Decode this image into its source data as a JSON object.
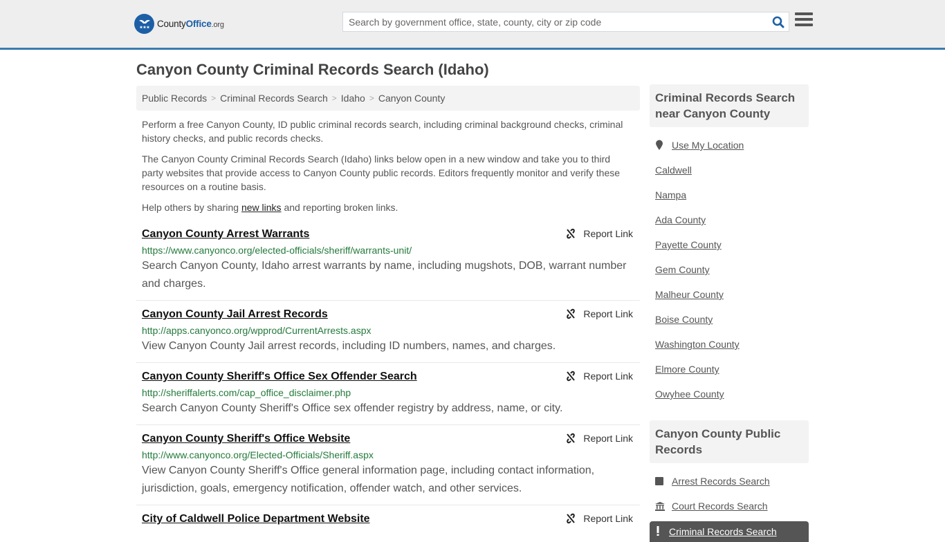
{
  "header": {
    "logo": {
      "county": "County",
      "office": "Office",
      "org": ".org"
    },
    "search_placeholder": "Search by government office, state, county, city or zip code",
    "search_value": "",
    "colors": {
      "brand": "#1d5fa6",
      "accent_line": "#3a7bb0"
    }
  },
  "page": {
    "title": "Canyon County Criminal Records Search (Idaho)"
  },
  "breadcrumb": [
    "Public Records",
    "Criminal Records Search",
    "Idaho",
    "Canyon County"
  ],
  "intro": {
    "p1": "Perform a free Canyon County, ID public criminal records search, including criminal background checks, criminal history checks, and public records checks.",
    "p2": "The Canyon County Criminal Records Search (Idaho) links below open in a new window and take you to third party websites that provide access to Canyon County public records. Editors frequently monitor and verify these resources on a routine basis.",
    "p3_before": "Help others by sharing ",
    "p3_link": "new links",
    "p3_after": " and reporting broken links."
  },
  "report_label": "Report Link",
  "results": [
    {
      "title": "Canyon County Arrest Warrants",
      "url": "https://www.canyonco.org/elected-officials/sheriff/warrants-unit/",
      "desc": "Search Canyon County, Idaho arrest warrants by name, including mugshots, DOB, warrant number and charges."
    },
    {
      "title": "Canyon County Jail Arrest Records",
      "url": "http://apps.canyonco.org/wpprod/CurrentArrests.aspx",
      "desc": "View Canyon County Jail arrest records, including ID numbers, names, and charges."
    },
    {
      "title": "Canyon County Sheriff's Office Sex Offender Search",
      "url": "http://sheriffalerts.com/cap_office_disclaimer.php",
      "desc": "Search Canyon County Sheriff's Office sex offender registry by address, name, or city."
    },
    {
      "title": "Canyon County Sheriff's Office Website",
      "url": "http://www.canyonco.org/Elected-Officials/Sheriff.aspx",
      "desc": "View Canyon County Sheriff's Office general information page, including contact information, jurisdiction, goals, emergency notification, offender watch, and other services."
    },
    {
      "title": "City of Caldwell Police Department Website",
      "url": "",
      "desc": ""
    }
  ],
  "sidebar": {
    "nearby_heading": "Criminal Records Search near Canyon County",
    "use_location": "Use My Location",
    "nearby": [
      "Caldwell",
      "Nampa",
      "Ada County",
      "Payette County",
      "Gem County",
      "Malheur County",
      "Boise County",
      "Washington County",
      "Elmore County",
      "Owyhee County"
    ],
    "public_heading": "Canyon County Public Records",
    "public_records": [
      {
        "label": "Arrest Records Search",
        "icon": "square-icon"
      },
      {
        "label": "Court Records Search",
        "icon": "courthouse-icon"
      },
      {
        "label": "Criminal Records Search",
        "icon": "exclamation-icon",
        "active": true
      }
    ]
  }
}
